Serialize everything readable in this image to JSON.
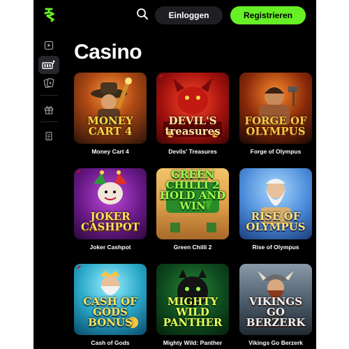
{
  "header": {
    "login_label": "Einloggen",
    "register_label": "Registrieren"
  },
  "page": {
    "title": "Casino"
  },
  "sidebar": {
    "items": [
      {
        "icon": "play-icon"
      },
      {
        "icon": "casino-icon",
        "active": true
      },
      {
        "icon": "live-casino-icon"
      },
      {
        "icon": "gift-icon"
      },
      {
        "icon": "document-icon"
      }
    ]
  },
  "colors": {
    "accent": "#66f025",
    "background": "#000000"
  },
  "games": [
    {
      "title": "Money Cart 4",
      "art_text": "MONEY CART 4"
    },
    {
      "title": "Devils' Treasures",
      "art_text": "DEVIL'S treasures"
    },
    {
      "title": "Forge of Olympus",
      "art_text": "FORGE OF OLYMPUS"
    },
    {
      "title": "Joker Cashpot",
      "art_text": "JOKER CASHPOT"
    },
    {
      "title": "Green Chilli 2",
      "art_text": "GREEN CHILLI 2 HOLD AND WIN"
    },
    {
      "title": "Rise of Olympus",
      "art_text": "RISE OF OLYMPUS"
    },
    {
      "title": "Cash of Gods",
      "art_text": "CASH OF GODS BONUS"
    },
    {
      "title": "Mighty Wild: Panther",
      "art_text": "MIGHTY WILD PANTHER"
    },
    {
      "title": "Vikings Go Berzerk",
      "art_text": "VIKINGS GO BERZERK"
    }
  ]
}
